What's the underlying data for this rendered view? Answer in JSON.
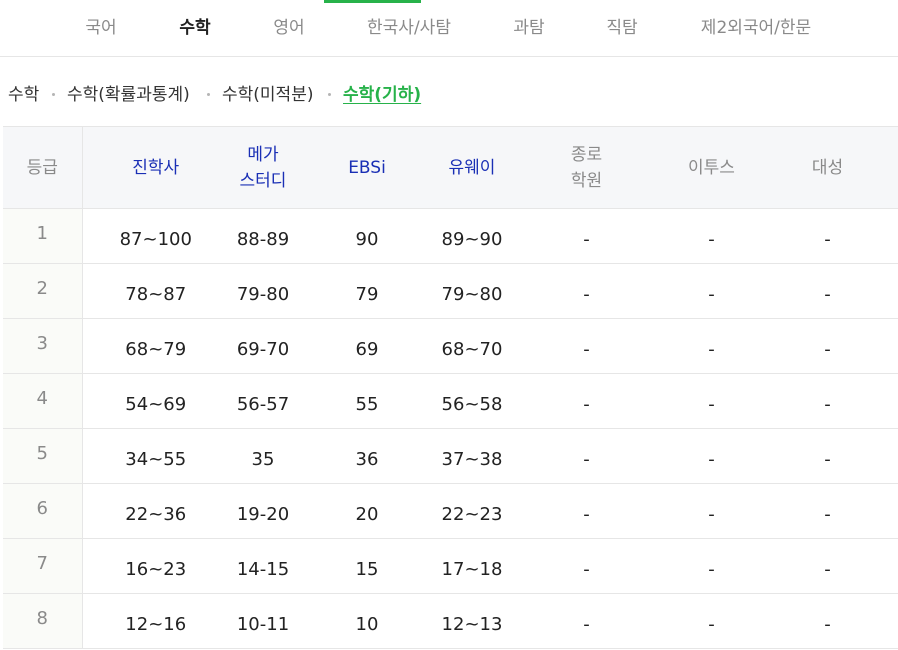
{
  "subject_tabs": [
    "국어",
    "수학",
    "영어",
    "한국사/사탐",
    "과탐",
    "직탐",
    "제2외국어/한문"
  ],
  "active_subject_tab": "수학",
  "sub_tabs": [
    "수학",
    "수학(확률과통계)",
    "수학(미적분)",
    "수학(기하)"
  ],
  "active_sub_tab": "수학(기하)",
  "table": {
    "headers": [
      {
        "lines": [
          "등급"
        ]
      },
      {
        "lines": [
          "진학사"
        ]
      },
      {
        "lines": [
          "메가",
          "스터디"
        ]
      },
      {
        "lines": [
          "EBSi"
        ]
      },
      {
        "lines": [
          "유웨이"
        ]
      },
      {
        "lines": [
          "종로",
          "학원"
        ]
      },
      {
        "lines": [
          "이투스"
        ]
      },
      {
        "lines": [
          "대성"
        ]
      }
    ],
    "rows": [
      [
        "1",
        "87~100",
        "88-89",
        "90",
        "89~90",
        "-",
        "-",
        "-"
      ],
      [
        "2",
        "78~87",
        "79-80",
        "79",
        "79~80",
        "-",
        "-",
        "-"
      ],
      [
        "3",
        "68~79",
        "69-70",
        "69",
        "68~70",
        "-",
        "-",
        "-"
      ],
      [
        "4",
        "54~69",
        "56-57",
        "55",
        "56~58",
        "-",
        "-",
        "-"
      ],
      [
        "5",
        "34~55",
        "35",
        "36",
        "37~38",
        "-",
        "-",
        "-"
      ],
      [
        "6",
        "22~36",
        "19-20",
        "20",
        "22~23",
        "-",
        "-",
        "-"
      ],
      [
        "7",
        "16~23",
        "14-15",
        "15",
        "17~18",
        "-",
        "-",
        "-"
      ],
      [
        "8",
        "12~16",
        "10-11",
        "10",
        "12~13",
        "-",
        "-",
        "-"
      ]
    ]
  },
  "colors": {
    "accent_green": "#27b24a",
    "header_blue": "#1a2fb5",
    "muted_gray": "#8a8a8a"
  }
}
